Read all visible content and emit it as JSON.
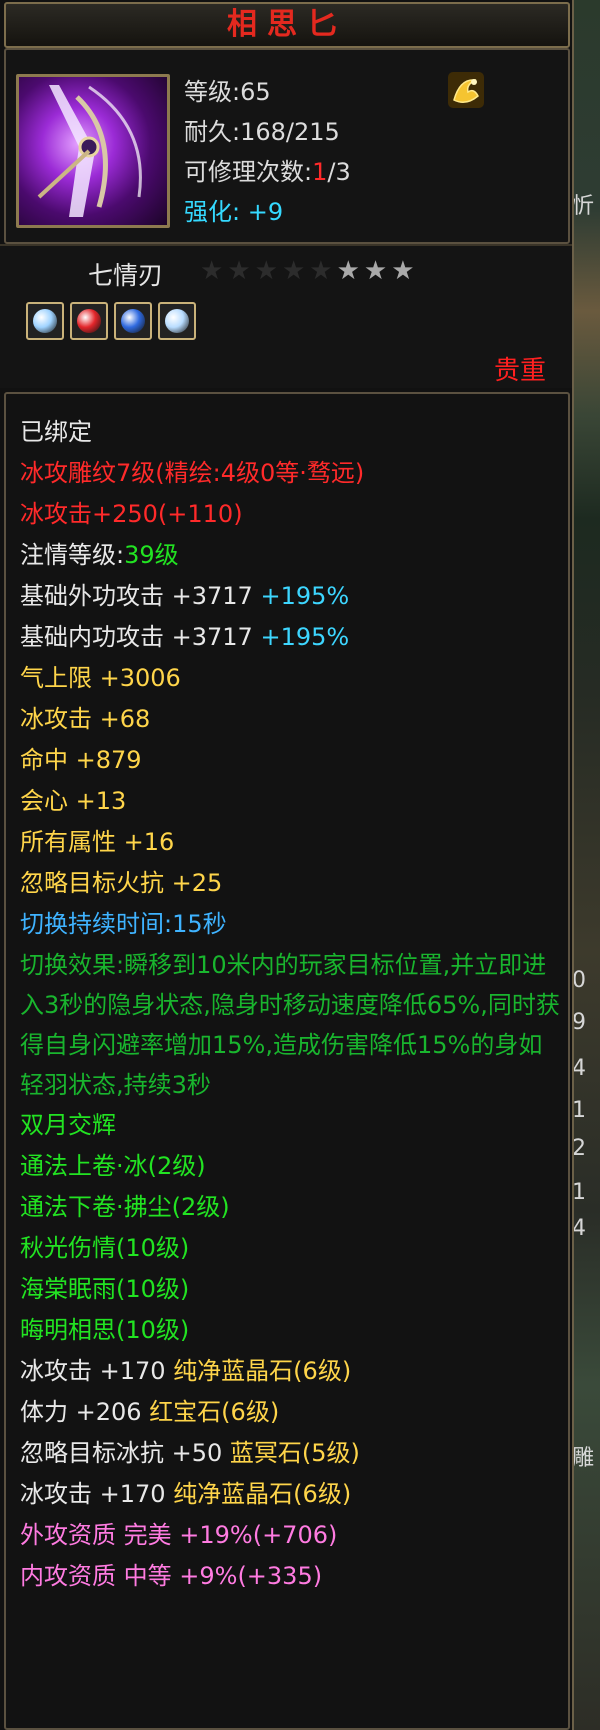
{
  "item": {
    "title": "相思匕",
    "level": "等级:65",
    "durability": "耐久:168/215",
    "repair_prefix": "可修理次数:",
    "repair_current": "1",
    "repair_suffix": "/3",
    "enhance_label": "强化: ",
    "enhance_value": "+9",
    "subtitle": "七情刃",
    "rarity": "贵重",
    "stars_total": 8,
    "stars_lit": 3
  },
  "colors": {
    "gem_1": "#9fd3ff",
    "gem_2": "#e3262b",
    "gem_3": "#2f6ae0",
    "gem_4": "#b8dcff"
  },
  "attributes": [
    {
      "segments": [
        {
          "text": "已绑定",
          "color": "white"
        }
      ]
    },
    {
      "segments": [
        {
          "text": "冰攻雕纹7级(精绘:4级0等·骛远)",
          "color": "red"
        }
      ]
    },
    {
      "segments": [
        {
          "text": "冰攻击+250(+110)",
          "color": "red"
        }
      ]
    },
    {
      "segments": [
        {
          "text": "注情等级:",
          "color": "white"
        },
        {
          "text": "39级",
          "color": "green"
        }
      ]
    },
    {
      "segments": [
        {
          "text": "基础外功攻击 +3717 ",
          "color": "white"
        },
        {
          "text": "+195%",
          "color": "cyan"
        }
      ]
    },
    {
      "segments": [
        {
          "text": "基础内功攻击 +3717 ",
          "color": "white"
        },
        {
          "text": "+195%",
          "color": "cyan"
        }
      ]
    },
    {
      "segments": [
        {
          "text": "气上限 +3006",
          "color": "yellow"
        }
      ]
    },
    {
      "segments": [
        {
          "text": "冰攻击 +68",
          "color": "yellow"
        }
      ]
    },
    {
      "segments": [
        {
          "text": "命中 +879",
          "color": "yellow"
        }
      ]
    },
    {
      "segments": [
        {
          "text": "会心 +13",
          "color": "yellow"
        }
      ]
    },
    {
      "segments": [
        {
          "text": "所有属性 +16",
          "color": "yellow"
        }
      ]
    },
    {
      "segments": [
        {
          "text": "忽略目标火抗 +25",
          "color": "yellow"
        }
      ]
    },
    {
      "segments": [
        {
          "text": "切换持续时间:15秒",
          "color": "blue"
        }
      ]
    },
    {
      "wrap": true,
      "segments": [
        {
          "text": "切换效果:瞬移到10米内的玩家目标位置,并立即进入3秒的隐身状态,隐身时移动速度降低65%,同时获得自身闪避率增加15%,造成伤害降低15%的身如轻羽状态,持续3秒",
          "color": "green2"
        }
      ]
    },
    {
      "segments": [
        {
          "text": "双月交辉",
          "color": "green"
        }
      ]
    },
    {
      "segments": [
        {
          "text": "通法上卷·冰(2级)",
          "color": "green"
        }
      ]
    },
    {
      "segments": [
        {
          "text": "通法下卷·拂尘(2级)",
          "color": "green"
        }
      ]
    },
    {
      "segments": [
        {
          "text": "秋光伤情(10级)",
          "color": "green"
        }
      ]
    },
    {
      "segments": [
        {
          "text": "海棠眠雨(10级)",
          "color": "green"
        }
      ]
    },
    {
      "segments": [
        {
          "text": "晦明相思(10级)",
          "color": "green"
        }
      ]
    },
    {
      "segments": [
        {
          "text": "冰攻击 +170 ",
          "color": "white"
        },
        {
          "text": "纯净蓝晶石(6级)",
          "color": "yellow"
        }
      ]
    },
    {
      "segments": [
        {
          "text": "体力 +206 ",
          "color": "white"
        },
        {
          "text": "红宝石(6级)",
          "color": "yellow"
        }
      ]
    },
    {
      "segments": [
        {
          "text": "忽略目标冰抗 +50 ",
          "color": "white"
        },
        {
          "text": "蓝冥石(5级)",
          "color": "yellow"
        }
      ]
    },
    {
      "segments": [
        {
          "text": "冰攻击 +170 ",
          "color": "white"
        },
        {
          "text": "纯净蓝晶石(6级)",
          "color": "yellow"
        }
      ]
    },
    {
      "segments": [
        {
          "text": "外攻资质  完美 +19%(+706)",
          "color": "pink"
        }
      ]
    },
    {
      "segments": [
        {
          "text": "内攻资质  中等 +9%(+335)",
          "color": "pink"
        }
      ]
    }
  ],
  "scene_glyphs": [
    "忻",
    "0",
    "9",
    "4",
    "1",
    "2",
    "1",
    "4",
    "雕"
  ]
}
